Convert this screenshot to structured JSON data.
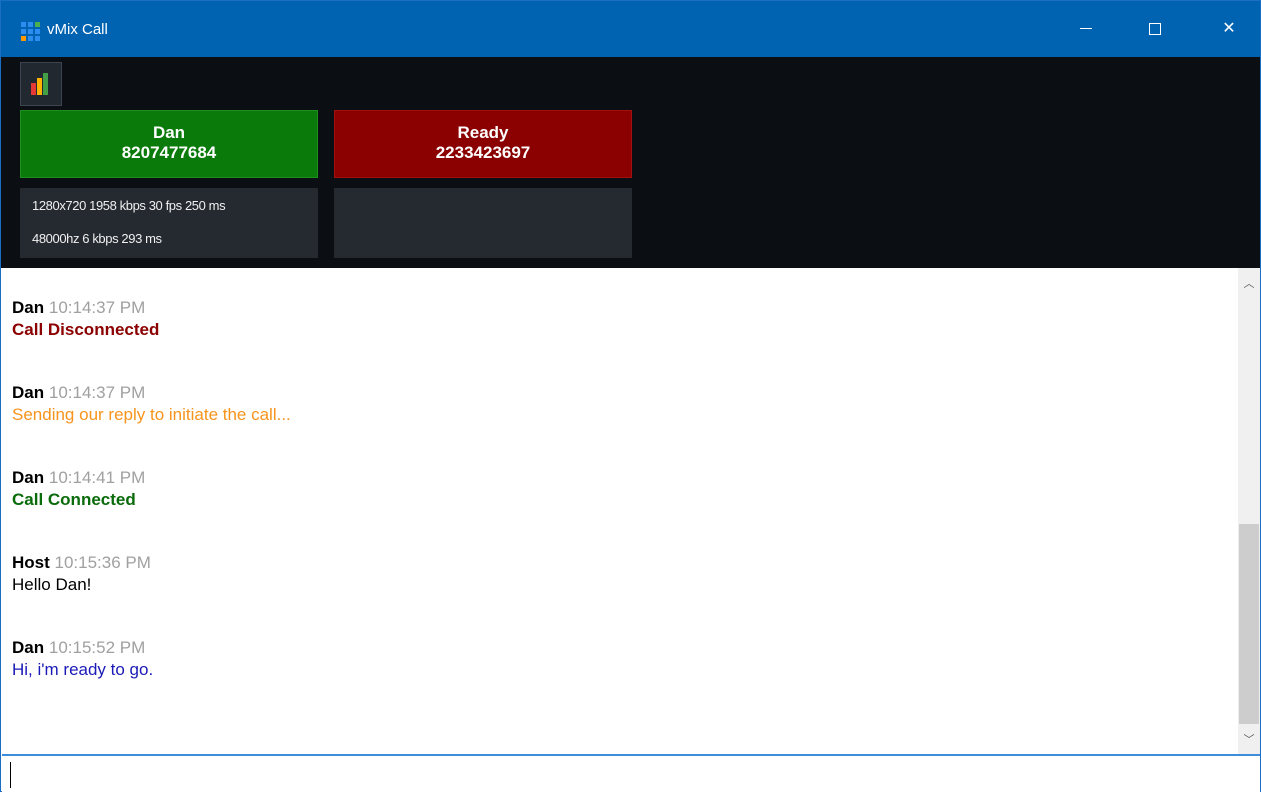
{
  "window": {
    "title": "vMix Call",
    "icon": "vmix-logo-icon"
  },
  "controls": {
    "minimize_icon": "minimize-icon",
    "maximize_icon": "maximize-icon",
    "close_icon": "close-icon"
  },
  "toolbar": {
    "meter_icon": "audio-meter-icon"
  },
  "tiles": [
    {
      "name": "Dan",
      "number": "8207477684",
      "color": "#0a7a0a"
    },
    {
      "name": "Ready",
      "number": "2233423697",
      "color": "#8b0000"
    }
  ],
  "stats": {
    "video": "1280x720 1958 kbps 30 fps 250 ms",
    "audio": "48000hz 6 kbps 293 ms"
  },
  "messages": [
    {
      "sender": "Dan",
      "time": "10:14:37 PM",
      "text": "Call Disconnected",
      "color": "#8b0000",
      "bold": true
    },
    {
      "sender": "Dan",
      "time": "10:14:37 PM",
      "text": "Sending our reply to initiate the call...",
      "color": "#f7941d",
      "bold": false
    },
    {
      "sender": "Dan",
      "time": "10:14:41 PM",
      "text": "Call Connected",
      "color": "#0a6b0a",
      "bold": true
    },
    {
      "sender": "Host",
      "time": "10:15:36 PM",
      "text": "Hello Dan!",
      "color": "#000000",
      "bold": false
    },
    {
      "sender": "Dan",
      "time": "10:15:52 PM",
      "text": "Hi, i'm ready to go.",
      "color": "#1a1ab8",
      "bold": false
    }
  ],
  "input": {
    "value": ""
  }
}
